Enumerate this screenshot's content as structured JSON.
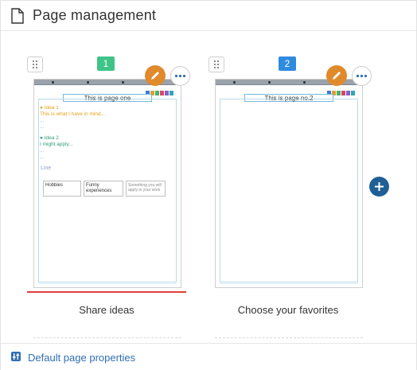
{
  "header": {
    "title": "Page management",
    "icon": "document-icon"
  },
  "pages": [
    {
      "number": "1",
      "number_color": "#3fc488",
      "thumb_title": "This is page one",
      "label": "Share ideas",
      "selected": true,
      "ideas": [
        {
          "title": "Idea 1",
          "text": "This is what I have in mind...",
          "dots": "...",
          "dots2": "..."
        },
        {
          "title": "Idea 2",
          "text": "I might apply...",
          "dots": "...",
          "dots2": "..."
        }
      ],
      "line_label": "Line",
      "cells": [
        "Hobbies",
        "Funny experiences",
        "Something you will apply in your work"
      ]
    },
    {
      "number": "2",
      "number_color": "#2f8be0",
      "thumb_title": "This is page no.2",
      "label": "Choose your favorites",
      "selected": false
    }
  ],
  "footer": {
    "label": "Default page properties",
    "icon": "page-properties-icon"
  },
  "colors": {
    "accent_blue": "#2f6fb3",
    "edit_orange": "#e08a2c",
    "add_button": "#1f5f96",
    "selected_underline": "#e04040"
  }
}
